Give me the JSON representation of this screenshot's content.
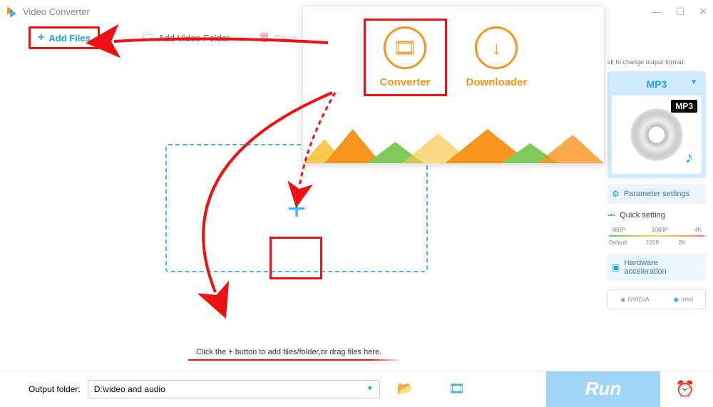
{
  "window": {
    "title": "Video Converter"
  },
  "toolbar": {
    "add_files": "Add Files",
    "add_folder": "Add Video Folder",
    "clear": "Clear"
  },
  "dropzone": {
    "hint": "Click the + button to add files/folder,or drag files here."
  },
  "sidebar": {
    "note": "ck to change output format:",
    "format": "MP3",
    "format_badge": "MP3",
    "param_btn": "Parameter settings",
    "quick": "Quick setting",
    "quality_top": [
      "480P",
      "1080P",
      "4K"
    ],
    "quality_bottom": [
      "Default",
      "720P",
      "2K",
      ""
    ],
    "hw_btn": "Hardware acceleration",
    "gpu": {
      "nvidia": "NVIDIA",
      "intel": "Intel"
    }
  },
  "bottom": {
    "label": "Output folder:",
    "path": "D:\\video and audio",
    "run": "Run"
  },
  "popup": {
    "converter": "Converter",
    "downloader": "Downloader"
  }
}
